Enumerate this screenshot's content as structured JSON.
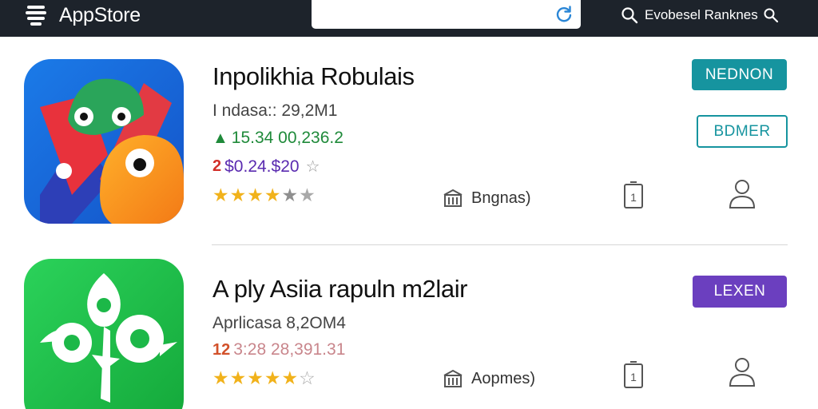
{
  "header": {
    "app_name": "AppStore",
    "search": {
      "value": "",
      "placeholder": ""
    },
    "right_label": "Evobesel Ranknes"
  },
  "apps": [
    {
      "title": "Inpolikhia Robulais",
      "meta": "I ndasa:: 29,2M1",
      "line_a": "15.34 00,236.2",
      "line_b": "$0.24.$20",
      "line_b_tag": "2",
      "rating": {
        "value": 4.5,
        "max": 5
      },
      "info_label": "Bngnas)",
      "primary_button": "NEDNON",
      "secondary_button": "BDMER"
    },
    {
      "title": "A ply Asiia rapuln m2lair",
      "meta": "Aprlicasa 8,2OM4",
      "line_a": "3:28 28,391.31",
      "line_a_tag": "12",
      "rating": {
        "value": 4.5,
        "max": 5
      },
      "info_label": "Aopmes)",
      "primary_button": "LEXEN"
    }
  ],
  "colors": {
    "topbar": "#1d232b",
    "teal": "#16949f",
    "purple": "#6b3fbf",
    "star": "#f1b21b",
    "green": "#1f8a3a",
    "violet": "#5a2bb0"
  },
  "icons": [
    "menu-stack-icon",
    "refresh-icon",
    "search-icon",
    "building-icon",
    "phone-icon",
    "person-icon",
    "star-icon"
  ]
}
